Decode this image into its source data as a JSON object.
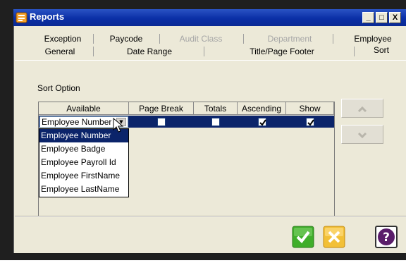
{
  "window": {
    "title": "Reports",
    "buttons": [
      "_",
      "□",
      "X"
    ]
  },
  "tabs": {
    "row1": [
      {
        "label": "Exception",
        "disabled": false
      },
      {
        "label": "Paycode",
        "disabled": false
      },
      {
        "label": "Audit Class",
        "disabled": true
      },
      {
        "label": "Department",
        "disabled": true
      },
      {
        "label": "Employee",
        "disabled": false
      }
    ],
    "row2": [
      {
        "label": "General"
      },
      {
        "label": "Date Range"
      },
      {
        "label": "Title/Page Footer"
      },
      {
        "label": "Sort"
      }
    ],
    "active": "Sort"
  },
  "sort": {
    "section_label": "Sort Option",
    "columns": [
      "Available",
      "Page Break",
      "Totals",
      "Ascending",
      "Show"
    ],
    "row": {
      "available": "Employee Number",
      "page_break": false,
      "totals": false,
      "ascending": true,
      "show": true
    },
    "dropdown_options": [
      "Employee Number",
      "Employee Badge",
      "Employee Payroll Id",
      "Employee FirstName",
      "Employee LastName"
    ],
    "dropdown_selected": "Employee Number"
  },
  "icons": {
    "move_up": "chevron-up-icon",
    "move_down": "chevron-down-icon",
    "ok": "check-icon",
    "cancel": "cross-icon",
    "help": "question-icon"
  },
  "colors": {
    "titlebar": "#0a2fa6",
    "selection": "#0b246a",
    "ok": "#3fae2a",
    "cancel": "#f2c037",
    "help": "#5a1d6a"
  }
}
